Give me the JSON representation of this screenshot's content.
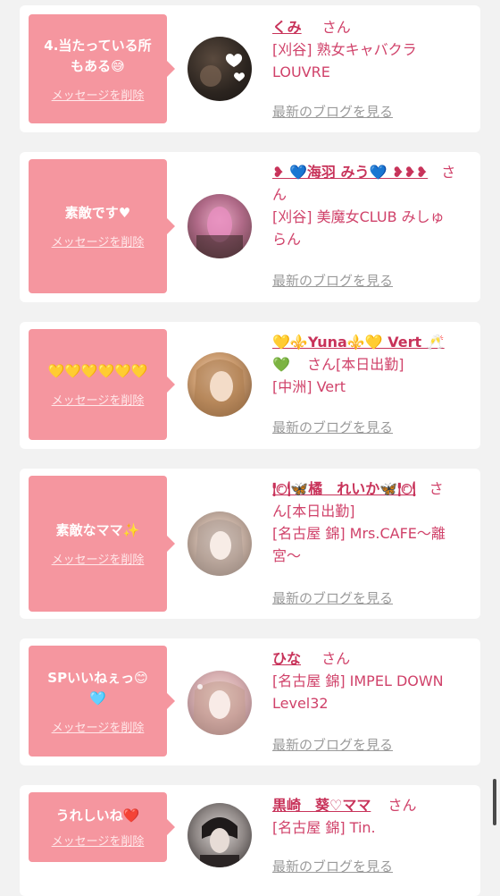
{
  "common": {
    "san": "さん",
    "delete_label": "メッセージを削除",
    "blog_label": "最新のブログを見る"
  },
  "cards": [
    {
      "message_line1": "4.当たっている所",
      "message_line2": "もある😅",
      "name": "くみ",
      "shop_line1": "[刈谷] 熟女キャバクラ",
      "shop_line2": "LOUVRE"
    },
    {
      "message_line1": "素敵です♥",
      "name_line1": "❥ 💙海羽 みう💙 ❥❥❥",
      "name_trail": "さ",
      "name_line2": "ん",
      "shop_line1": "[刈谷] 美魔女CLUB みしゅ",
      "shop_line2": "らん"
    },
    {
      "message_line1": "💛💛💛💛💛💛",
      "name_line1": "💛⚜️Yuna⚜️💛 Vert 🥂",
      "name_line2": "💚",
      "status": "[本日出勤]",
      "shop_line1": "[中洲] Vert"
    },
    {
      "message_line1": "素敵なママ✨",
      "name_line1": "🍽🦋橘　れいか🦋🍽",
      "name_trail": "さ",
      "name_line2": "ん",
      "status": "[本日出勤]",
      "shop_line1": "[名古屋 錦] Mrs.CAFE〜離",
      "shop_line2": "宮〜"
    },
    {
      "message_line1": "SPいいねぇっ😊",
      "message_line2": "🩵",
      "name": "ひな",
      "shop_line1": "[名古屋 錦] IMPEL DOWN",
      "shop_line2": "Level32"
    },
    {
      "message_line1": "うれしいね❤️",
      "name": "黒崎　葵♡ママ",
      "shop_line1": "[名古屋 錦] Tin."
    }
  ]
}
